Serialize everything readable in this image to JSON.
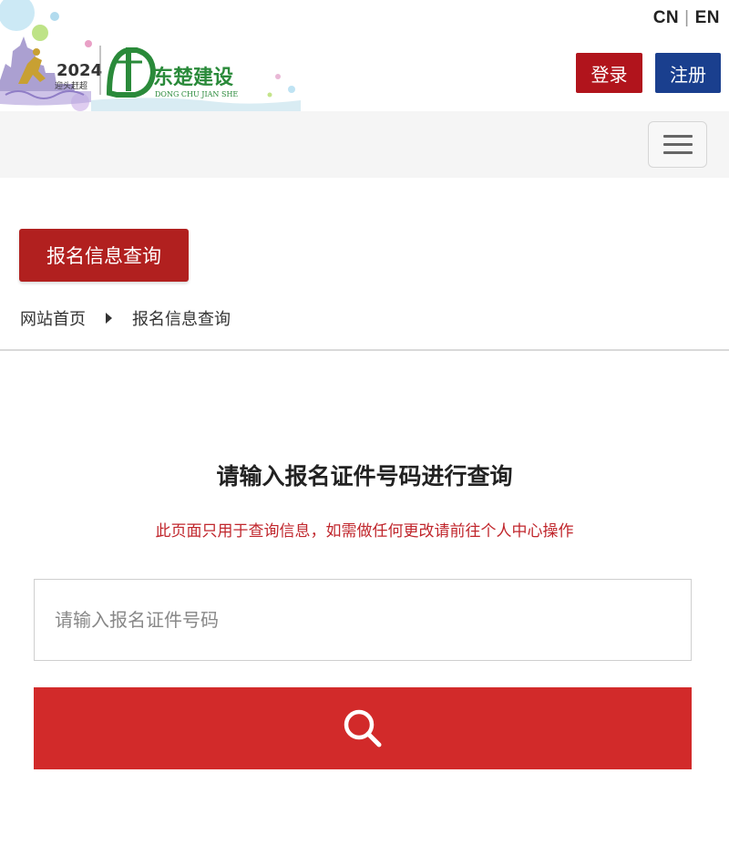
{
  "header": {
    "logo": {
      "year": "2024",
      "event_cn": "迎头赶超",
      "brand_cn": "东楚建设",
      "brand_en": "DONG CHU JIAN SHE"
    },
    "lang": {
      "cn": "CN",
      "separator": "|",
      "en": "EN"
    },
    "login_label": "登录",
    "register_label": "注册",
    "colors": {
      "login": "#b1141c",
      "register": "#1a3f8e",
      "brand_green": "#2a8a3a"
    }
  },
  "navbar": {
    "menu_icon": "hamburger-icon"
  },
  "page": {
    "section_title": "报名信息查询",
    "breadcrumb": {
      "home": "网站首页",
      "current": "报名信息查询"
    }
  },
  "query": {
    "title": "请输入报名证件号码进行查询",
    "note": "此页面只用于查询信息，如需做任何更改请前往个人中心操作",
    "input_placeholder": "请输入报名证件号码",
    "search_icon": "search-icon",
    "button_color": "#d22a2a"
  }
}
